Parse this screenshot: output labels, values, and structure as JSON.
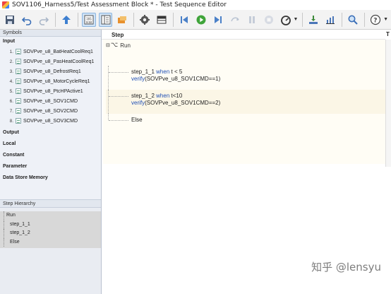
{
  "window": {
    "title": "SOV1106_Harness5/Test Assessment Block * - Test Sequence Editor"
  },
  "toolbar": {
    "buttons": [
      {
        "icon": "save-icon"
      },
      {
        "icon": "undo-icon"
      },
      {
        "icon": "redo-icon"
      },
      {
        "icon": "up-arrow-icon"
      },
      {
        "icon": "symbol-pane-icon",
        "active": true
      },
      {
        "icon": "property-pane-icon",
        "active": true
      },
      {
        "icon": "data-icon"
      },
      {
        "icon": "gear-icon"
      },
      {
        "icon": "table-icon"
      },
      {
        "icon": "step-back-icon"
      },
      {
        "icon": "run-icon"
      },
      {
        "icon": "step-forward-icon"
      },
      {
        "icon": "step-icon"
      },
      {
        "icon": "pause-icon"
      },
      {
        "icon": "stop-icon"
      },
      {
        "icon": "gauge-icon"
      },
      {
        "icon": "download-icon"
      },
      {
        "icon": "chart-icon"
      },
      {
        "icon": "search-icon"
      },
      {
        "icon": "help-icon"
      }
    ]
  },
  "symbols": {
    "header": "Symbols",
    "sections": {
      "input": "Input",
      "output": "Output",
      "local": "Local",
      "constant": "Constant",
      "parameter": "Parameter",
      "data_store_memory": "Data Store Memory"
    },
    "inputs": [
      {
        "num": "1.",
        "name": "SOVPve_u8_BatHeatCoolReq1"
      },
      {
        "num": "2.",
        "name": "SOVPve_u8_PasHeatCoolReq1"
      },
      {
        "num": "3.",
        "name": "SOVPve_u8_DefrostReq1"
      },
      {
        "num": "4.",
        "name": "SOVPve_u8_MotorCycleReq1"
      },
      {
        "num": "5.",
        "name": "SOVPve_u8_PtcHPActive1"
      },
      {
        "num": "6.",
        "name": "SOVPve_u8_SOV1CMD"
      },
      {
        "num": "7.",
        "name": "SOVPve_u8_SOV2CMD"
      },
      {
        "num": "8.",
        "name": "SOVPve_u8_SOV3CMD"
      }
    ]
  },
  "hierarchy": {
    "header": "Step Hierarchy",
    "items": [
      {
        "label": "Run"
      },
      {
        "label": "step_1_1"
      },
      {
        "label": "step_1_2"
      },
      {
        "label": "Else"
      }
    ]
  },
  "editor": {
    "column_step": "Step",
    "column_right": "T",
    "run_label": "Run",
    "run_expander": "⊟",
    "run_icon": "⌥",
    "steps": [
      {
        "name": "step_1_1",
        "when": "when",
        "cond": "t < 5",
        "verify": "verify",
        "verify_arg": "(SOVPve_u8_SOV1CMD==1)"
      },
      {
        "name": "step_1_2",
        "when": "when",
        "cond": "t<10",
        "verify": "verify",
        "verify_arg": "(SOVPve_u8_SOV1CMD==2)"
      }
    ],
    "else_label": "Else"
  },
  "watermark": "知乎 @lensyu"
}
